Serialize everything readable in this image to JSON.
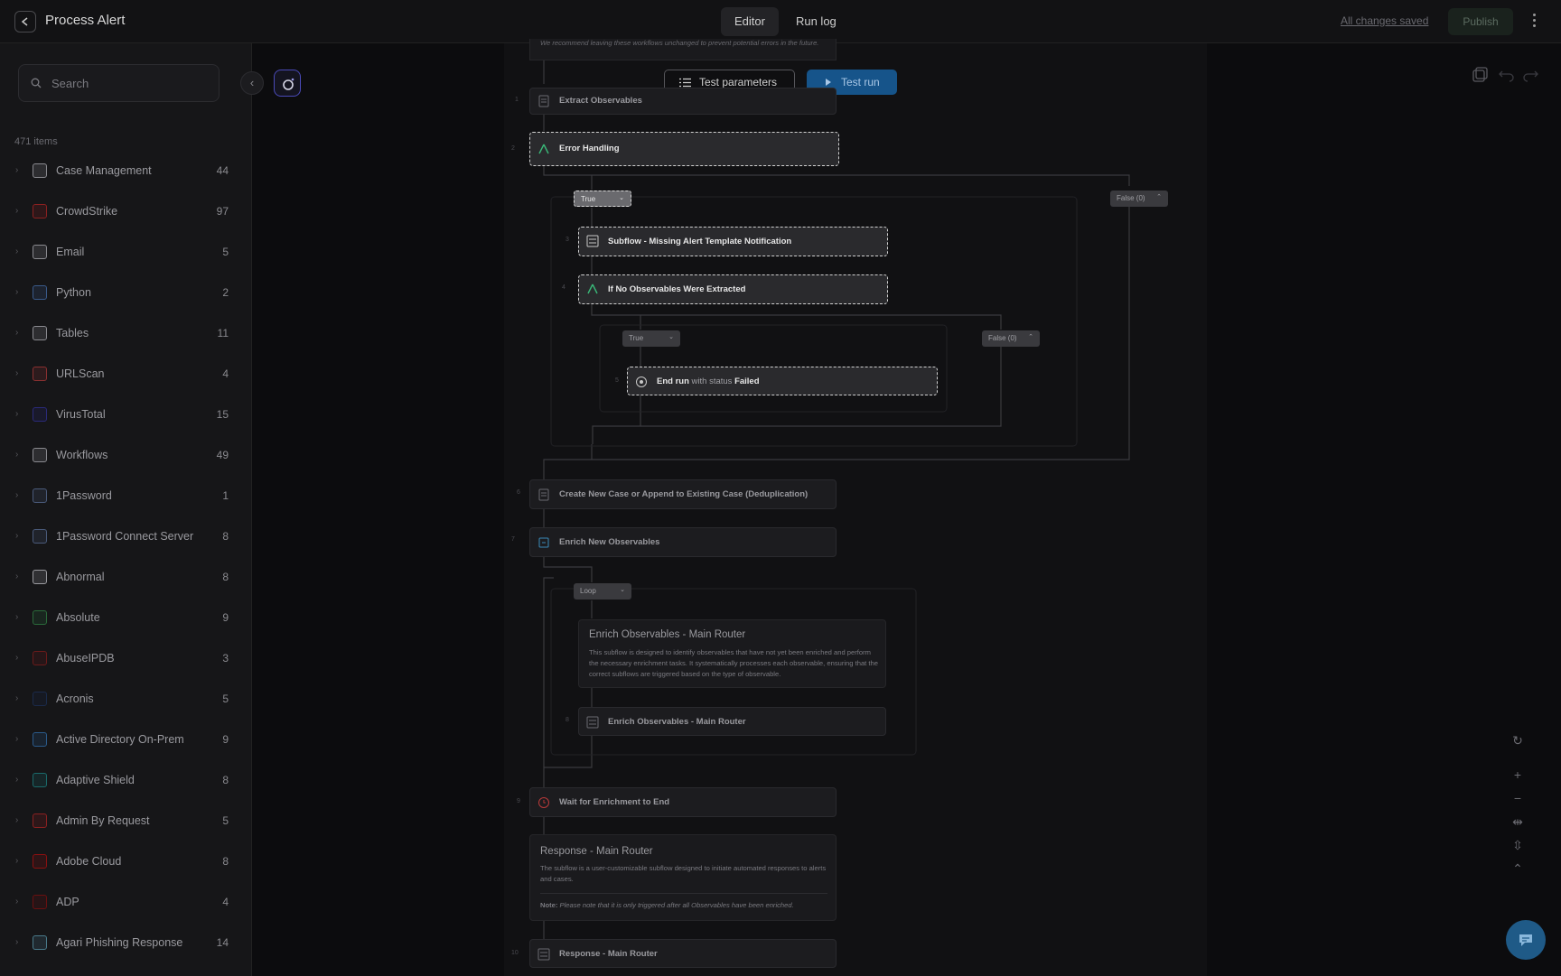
{
  "header": {
    "title": "Process Alert",
    "tabs": [
      {
        "label": "Editor",
        "active": true
      },
      {
        "label": "Run log",
        "active": false
      }
    ],
    "saved_status": "All changes saved",
    "publish_label": "Publish"
  },
  "sidebar": {
    "search_placeholder": "Search",
    "item_count": "471 items",
    "items": [
      {
        "label": "Case Management",
        "count": "44",
        "icon": "case-management-icon",
        "color": "#8a8a8f"
      },
      {
        "label": "CrowdStrike",
        "count": "97",
        "icon": "crowdstrike-icon",
        "color": "#8a2020"
      },
      {
        "label": "Email",
        "count": "5",
        "icon": "email-icon",
        "color": "#8a8a8f"
      },
      {
        "label": "Python",
        "count": "2",
        "icon": "python-icon",
        "color": "#3a5a8a"
      },
      {
        "label": "Tables",
        "count": "11",
        "icon": "tables-icon",
        "color": "#8a8a8f"
      },
      {
        "label": "URLScan",
        "count": "4",
        "icon": "urlscan-icon",
        "color": "#8a3030"
      },
      {
        "label": "VirusTotal",
        "count": "15",
        "icon": "virustotal-icon",
        "color": "#2a2a7a"
      },
      {
        "label": "Workflows",
        "count": "49",
        "icon": "workflows-icon",
        "color": "#8a8a8f"
      },
      {
        "label": "1Password",
        "count": "1",
        "icon": "1password-icon",
        "color": "#4a5a7a"
      },
      {
        "label": "1Password Connect Server",
        "count": "8",
        "icon": "1password-connect-icon",
        "color": "#4a5a7a"
      },
      {
        "label": "Abnormal",
        "count": "8",
        "icon": "abnormal-icon",
        "color": "#9a9a9f"
      },
      {
        "label": "Absolute",
        "count": "9",
        "icon": "absolute-icon",
        "color": "#2a6a3a"
      },
      {
        "label": "AbuseIPDB",
        "count": "3",
        "icon": "abuseipdb-icon",
        "color": "#6a1a1a"
      },
      {
        "label": "Acronis",
        "count": "5",
        "icon": "acronis-icon",
        "color": "#1a2a4a"
      },
      {
        "label": "Active Directory On-Prem",
        "count": "9",
        "icon": "active-directory-icon",
        "color": "#2a5a8a"
      },
      {
        "label": "Adaptive Shield",
        "count": "8",
        "icon": "adaptive-shield-icon",
        "color": "#1a6a6a"
      },
      {
        "label": "Admin By Request",
        "count": "5",
        "icon": "admin-by-request-icon",
        "color": "#8a2020"
      },
      {
        "label": "Adobe Cloud",
        "count": "8",
        "icon": "adobe-cloud-icon",
        "color": "#8a1010"
      },
      {
        "label": "ADP",
        "count": "4",
        "icon": "adp-icon",
        "color": "#6a1010"
      },
      {
        "label": "Agari Phishing Response",
        "count": "14",
        "icon": "agari-icon",
        "color": "#4a7a8a"
      }
    ]
  },
  "toolbar": {
    "test_parameters": "Test parameters",
    "test_run": "Test run"
  },
  "canvas": {
    "top_note": "We recommend leaving these workflows unchanged to prevent potential errors in the future.",
    "nodes": {
      "extract": {
        "step": "1",
        "label": "Extract Observables"
      },
      "error": {
        "step": "2",
        "label": "Error Handling"
      },
      "subflow_missing": {
        "step": "3",
        "label": "Subflow - Missing Alert Template Notification"
      },
      "no_obs": {
        "step": "4",
        "label": "If No Observables Were Extracted"
      },
      "end_run": {
        "step": "5",
        "prefix": "End run",
        "mid": "with status",
        "status": "Failed"
      },
      "create_case": {
        "step": "6",
        "label": "Create New Case or Append to Existing Case (Deduplication)"
      },
      "enrich": {
        "step": "7",
        "label": "Enrich New Observables"
      },
      "enrich_router": {
        "step": "8",
        "label": "Enrich Observables - Main Router"
      },
      "wait": {
        "step": "9",
        "label": "Wait for Enrichment to End"
      },
      "response_router": {
        "step": "10",
        "label": "Response - Main Router"
      }
    },
    "conditions": {
      "true1": "True",
      "false1": "False (0)",
      "true2": "True",
      "false2": "False (0)",
      "loop": "Loop"
    },
    "enrich_card": {
      "title": "Enrich Observables - Main Router",
      "desc": "This subflow is designed to identify observables that have not yet been enriched and perform the necessary enrichment tasks. It systematically processes each observable, ensuring that the correct subflows are triggered based on the type of observable."
    },
    "response_card": {
      "title": "Response - Main Router",
      "desc": "The subflow is a user-customizable subflow designed to initiate automated responses to alerts and cases.",
      "note_label": "Note:",
      "note_text": "Please note that it is only triggered after all Observables have been enriched."
    }
  },
  "colors": {
    "accent": "#16548a",
    "canvas_bg": "#0c0c0e",
    "sidebar_bg": "#161618",
    "branch_green": "#3ab878"
  }
}
